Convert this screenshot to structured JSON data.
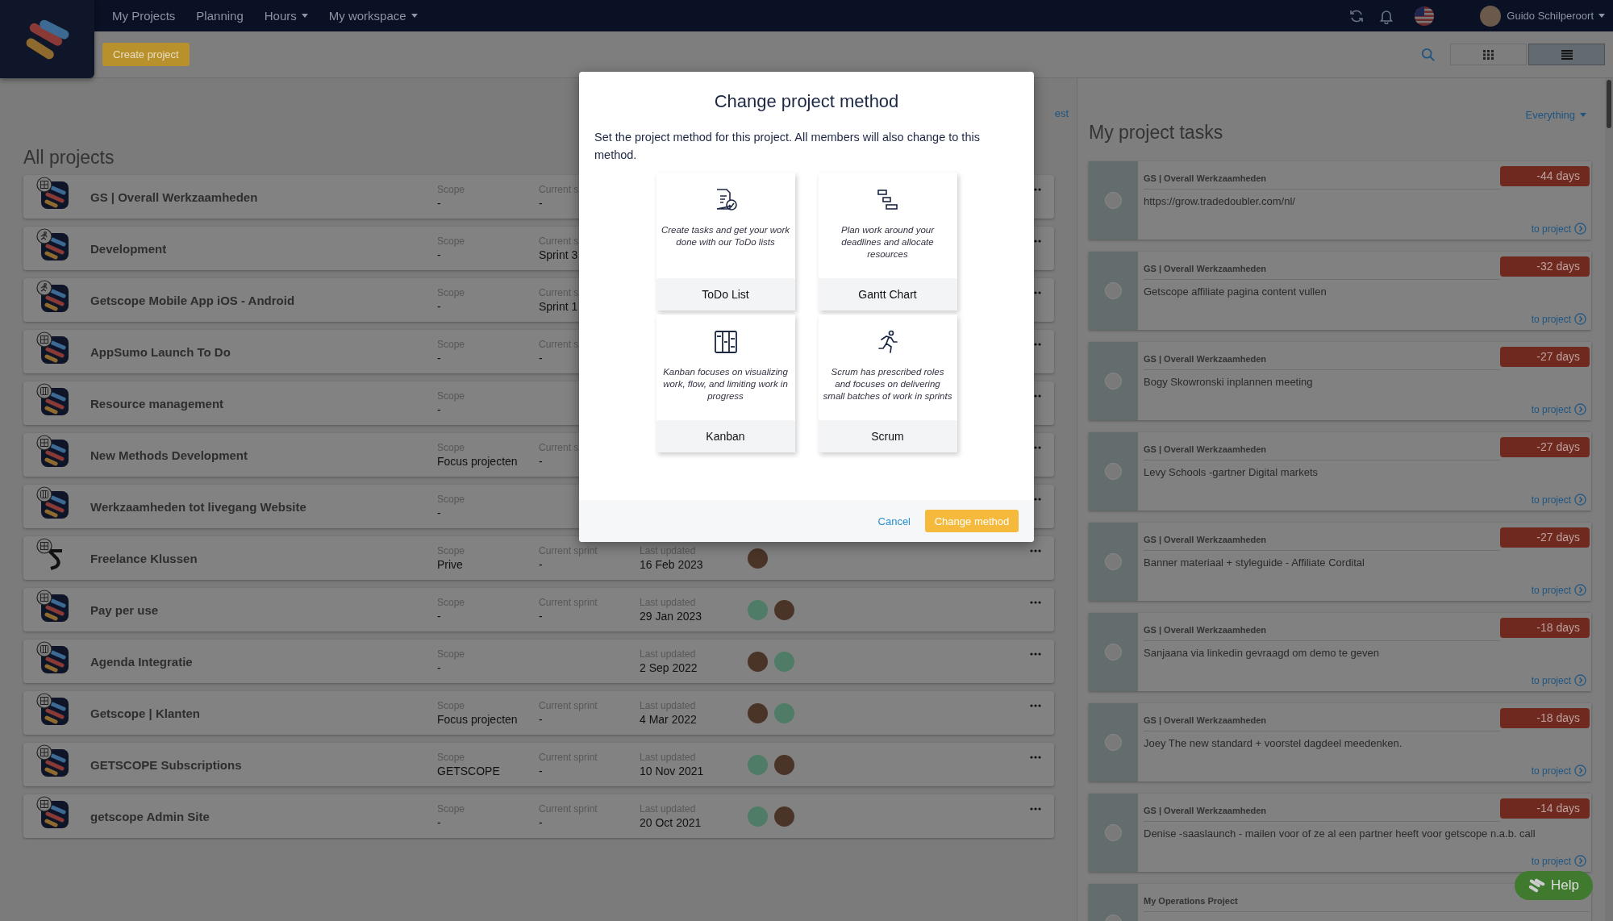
{
  "nav": {
    "items": [
      {
        "label": "My Projects",
        "dropdown": false
      },
      {
        "label": "Planning",
        "dropdown": false
      },
      {
        "label": "Hours",
        "dropdown": true
      },
      {
        "label": "My workspace",
        "dropdown": true
      }
    ],
    "user": "Guido Schilperoort"
  },
  "toolbar": {
    "create_button": "Create project",
    "views": [
      {
        "kind": "grid",
        "selected": false
      },
      {
        "kind": "list",
        "selected": true
      }
    ]
  },
  "projects_panel": {
    "top_link": "est",
    "title": "All projects",
    "rows": [
      {
        "name": "GS | Overall Werkzaamheden",
        "kind": "grid",
        "scope_label": "Scope",
        "scope": "-",
        "sprint_label": "Current s",
        "sprint": "-"
      },
      {
        "name": "Development",
        "kind": "runner",
        "scope_label": "Scope",
        "scope": "-",
        "sprint_label": "Current s",
        "sprint": "Sprint 3"
      },
      {
        "name": "Getscope Mobile App iOS - Android",
        "kind": "runner",
        "scope_label": "Scope",
        "scope": "-",
        "sprint_label": "Current s",
        "sprint": "Sprint 1"
      },
      {
        "name": "AppSumo Launch To Do",
        "kind": "grid",
        "scope_label": "Scope",
        "scope": "-",
        "sprint_label": "Current s",
        "sprint": "-"
      },
      {
        "name": "Resource management",
        "kind": "columns",
        "scope_label": "Scope",
        "scope": "-"
      },
      {
        "name": "New Methods Development",
        "kind": "grid",
        "scope_label": "Scope",
        "scope": "Focus projecten",
        "sprint_label": "Current s",
        "sprint": "-"
      },
      {
        "name": "Werkzaamheden tot livegang Website",
        "kind": "columns",
        "scope_label": "Scope",
        "scope": "-"
      },
      {
        "name": "Freelance Klussen",
        "kind": "letter",
        "scope_label": "Scope",
        "scope": "Prive",
        "sprint_label": "Current sprint",
        "sprint": "-",
        "updated_label": "Last updated",
        "updated": "16 Feb 2023",
        "avatars": [
          {
            "color": "#4a3428"
          }
        ]
      },
      {
        "name": "Pay per use",
        "kind": "grid",
        "scope_label": "Scope",
        "scope": "-",
        "sprint_label": "Current sprint",
        "sprint": "-",
        "updated_label": "Last updated",
        "updated": "29 Jan 2023",
        "avatars": [
          {
            "color": "#4e7c66"
          },
          {
            "color": "#4a3428"
          }
        ]
      },
      {
        "name": "Agenda Integratie",
        "kind": "columns",
        "scope_label": "Scope",
        "scope": "-",
        "updated_label": "Last updated",
        "updated": "2 Sep 2022",
        "avatars": [
          {
            "color": "#4a3428"
          },
          {
            "color": "#4e7c66"
          }
        ]
      },
      {
        "name": "Getscope | Klanten",
        "kind": "grid",
        "scope_label": "Scope",
        "scope": "Focus projecten",
        "sprint_label": "Current sprint",
        "sprint": "-",
        "updated_label": "Last updated",
        "updated": "4 Mar 2022",
        "avatars": [
          {
            "color": "#4a3428"
          },
          {
            "color": "#4e7c66"
          }
        ]
      },
      {
        "name": "GETSCOPE Subscriptions",
        "kind": "grid",
        "scope_label": "Scope",
        "scope": "GETSCOPE",
        "sprint_label": "Current sprint",
        "sprint": "-",
        "updated_label": "Last updated",
        "updated": "10 Nov 2021",
        "avatars": [
          {
            "color": "#4e7c66"
          },
          {
            "color": "#4a3428"
          }
        ]
      },
      {
        "name": "getscope Admin Site",
        "kind": "grid",
        "scope_label": "Scope",
        "scope": "-",
        "sprint_label": "Current sprint",
        "sprint": "-",
        "updated_label": "Last updated",
        "updated": "20 Oct 2021",
        "avatars": [
          {
            "color": "#4e7c66"
          },
          {
            "color": "#4a3428"
          }
        ]
      }
    ]
  },
  "tasks_panel": {
    "filter": "Everything",
    "title": "My project tasks",
    "tasks": [
      {
        "project": "GS | Overall Werkzaamheden",
        "text": "https://grow.tradedoubler.com/nl/",
        "due": "-44 days",
        "link": "to project",
        "done": false
      },
      {
        "project": "GS | Overall Werkzaamheden",
        "text": "Getscope affiliate pagina content vullen",
        "due": "-32 days",
        "link": "to project",
        "done": false
      },
      {
        "project": "GS | Overall Werkzaamheden",
        "text": "Bogy Skowronski inplannen meeting",
        "due": "-27 days",
        "link": "to project",
        "done": false
      },
      {
        "project": "GS | Overall Werkzaamheden",
        "text": "Levy Schools -gartner Digital markets",
        "due": "-27 days",
        "link": "to project",
        "done": false
      },
      {
        "project": "GS | Overall Werkzaamheden",
        "text": "Banner materiaal + styleguide - Affiliate Cordital",
        "due": "-27 days",
        "link": "to project",
        "done": false
      },
      {
        "project": "GS | Overall Werkzaamheden",
        "text": "Sanjaana via linkedin gevraagd om demo te geven",
        "due": "-18 days",
        "link": "to project",
        "done": false
      },
      {
        "project": "GS | Overall Werkzaamheden",
        "text": "Joey The new standard + voorstel dagdeel meedenken.",
        "due": "-18 days",
        "link": "to project",
        "done": false
      },
      {
        "project": "GS | Overall Werkzaamheden",
        "text": "Denise -saaslaunch - mailen voor of ze al een partner heeft voor getscope n.a.b. call",
        "due": "-14 days",
        "link": "to project",
        "done": false
      },
      {
        "project": "My Operations Project",
        "done": false
      }
    ]
  },
  "help_button": "Help",
  "modal": {
    "title": "Change project method",
    "description": "Set the project method for this project. All members will also change to this method.",
    "methods": [
      {
        "kind": "todo",
        "description": "Create tasks and get your work done with our ToDo lists",
        "label": "ToDo List"
      },
      {
        "kind": "gantt",
        "description": "Plan work around your deadlines and allocate resources",
        "label": "Gantt Chart"
      },
      {
        "kind": "kanban",
        "description": "Kanban focuses on visualizing work, flow, and limiting work in progress",
        "label": "Kanban"
      },
      {
        "kind": "scrum",
        "description": "Scrum has prescribed roles and focuses on delivering small batches of work in sprints",
        "label": "Scrum"
      }
    ],
    "cancel": "Cancel",
    "confirm": "Change method"
  }
}
